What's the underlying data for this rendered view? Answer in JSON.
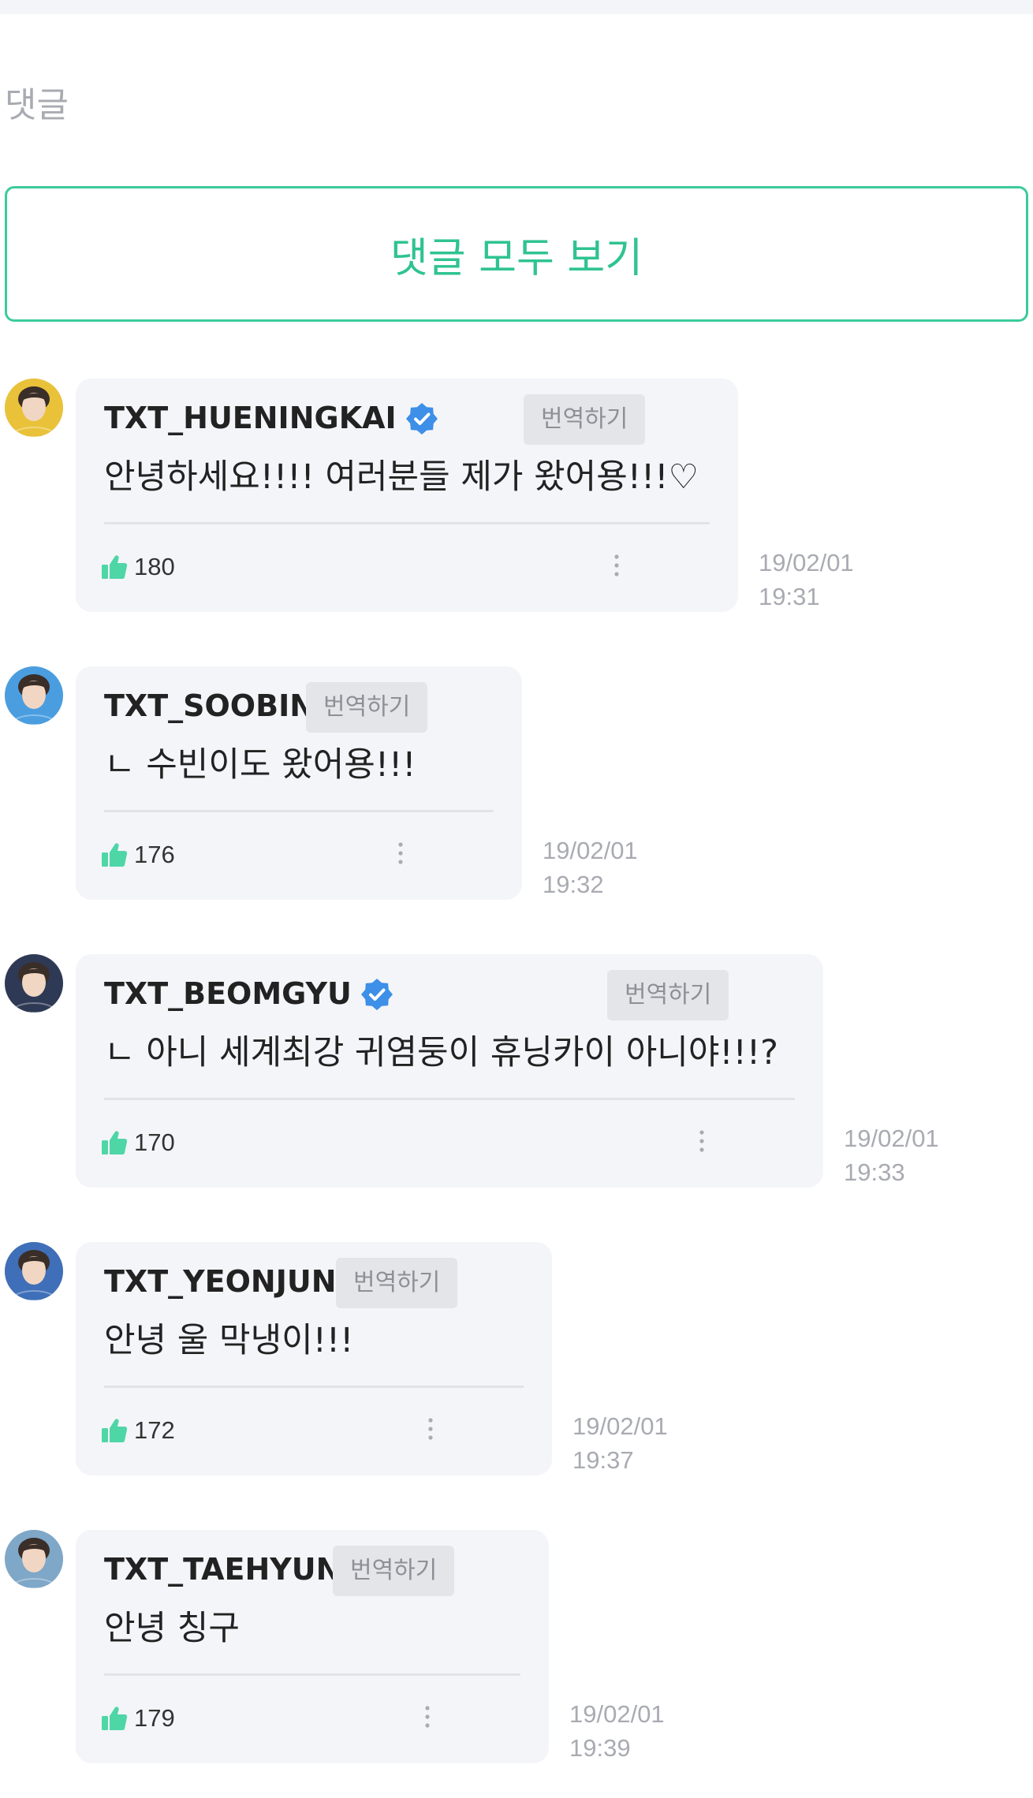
{
  "section_title": "댓글",
  "view_all_label": "댓글 모두 보기",
  "translate_label": "번역하기",
  "colors": {
    "accent": "#3ccb9a",
    "verified": "#3d8fe8",
    "bubble_bg": "#f4f5f9",
    "muted_text": "#a9abb2"
  },
  "comments": [
    {
      "username": "TXT_HUENINGKAI",
      "text": "안녕하세요!!!! 여러분들 제가 왔어용!!!♡",
      "likes": "180",
      "date": "19/02/01",
      "time": "19:31",
      "avatar_color": "#e9c23a"
    },
    {
      "username": "TXT_SOOBIN",
      "text": "ㄴ 수빈이도 왔어용!!!",
      "likes": "176",
      "date": "19/02/01",
      "time": "19:32",
      "avatar_color": "#4a9ee0"
    },
    {
      "username": "TXT_BEOMGYU",
      "text": "ㄴ 아니 세계최강 귀염둥이 휴닝카이 아니야!!!?",
      "likes": "170",
      "date": "19/02/01",
      "time": "19:33",
      "avatar_color": "#2e3a55"
    },
    {
      "username": "TXT_YEONJUN",
      "text": "안녕 울 막냉이!!!",
      "likes": "172",
      "date": "19/02/01",
      "time": "19:37",
      "avatar_color": "#3f6fb8"
    },
    {
      "username": "TXT_TAEHYUN",
      "text": "안녕 칭구",
      "likes": "179",
      "date": "19/02/01",
      "time": "19:39",
      "avatar_color": "#7fa7c8"
    }
  ]
}
